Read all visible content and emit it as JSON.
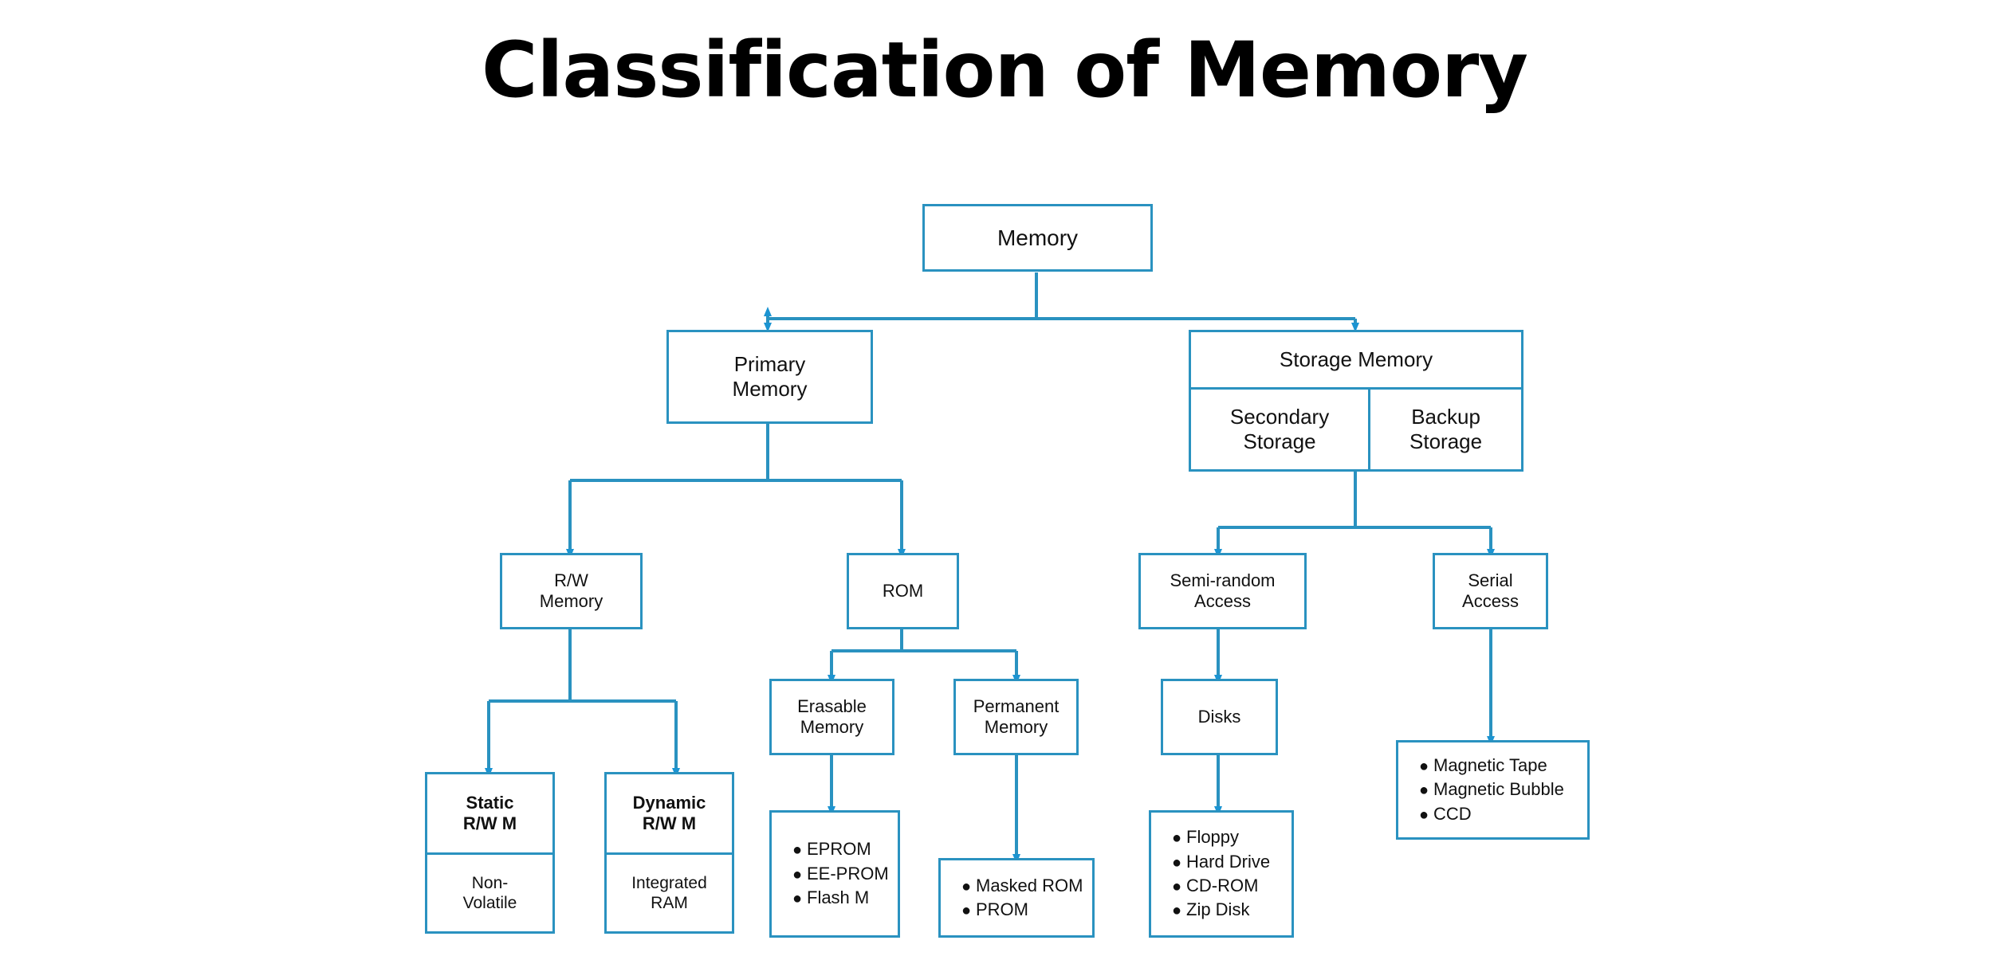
{
  "page": {
    "title": "Classification of Memory"
  },
  "theme": {
    "line_color": "#2a92c0",
    "arrow_color": "#1b94d2",
    "box_fill": "#ffffff",
    "text_color": "#111111",
    "title_color": "#000000",
    "background": "#ffffff"
  },
  "chart_data": {
    "type": "diagram",
    "subtype": "tree",
    "title": "Classification of Memory",
    "orientation": "top-down",
    "root": "Memory",
    "nodes": [
      {
        "id": "memory",
        "label": "Memory",
        "level": 0
      },
      {
        "id": "primary_memory",
        "label": "Primary Memory",
        "level": 1
      },
      {
        "id": "storage_memory",
        "label": "Storage Memory",
        "level": 1
      },
      {
        "id": "secondary_storage",
        "label": "Secondary Storage",
        "level": 1
      },
      {
        "id": "backup_storage",
        "label": "Backup Storage",
        "level": 1
      },
      {
        "id": "rw_memory",
        "label": "R/W Memory",
        "level": 2
      },
      {
        "id": "rom",
        "label": "ROM",
        "level": 2
      },
      {
        "id": "semi_random_access",
        "label": "Semi-random Access",
        "level": 2
      },
      {
        "id": "serial_access",
        "label": "Serial Access",
        "level": 2
      },
      {
        "id": "erasable_memory",
        "label": "Erasable Memory",
        "level": 3
      },
      {
        "id": "permanent_memory",
        "label": "Permanent Memory",
        "level": 3
      },
      {
        "id": "disks",
        "label": "Disks",
        "level": 3
      },
      {
        "id": "static_rw_m",
        "label": "Static R/W M",
        "level": 4
      },
      {
        "id": "dynamic_rw_m",
        "label": "Dynamic R/W M",
        "level": 4
      }
    ],
    "edges": [
      {
        "from": "memory",
        "to": "primary_memory"
      },
      {
        "from": "memory",
        "to": "storage_memory"
      },
      {
        "from": "primary_memory",
        "to": "rw_memory"
      },
      {
        "from": "primary_memory",
        "to": "rom"
      },
      {
        "from": "storage_memory",
        "to": "semi_random_access"
      },
      {
        "from": "storage_memory",
        "to": "serial_access"
      },
      {
        "from": "rw_memory",
        "to": "static_rw_m"
      },
      {
        "from": "rw_memory",
        "to": "dynamic_rw_m"
      },
      {
        "from": "rom",
        "to": "erasable_memory"
      },
      {
        "from": "rom",
        "to": "permanent_memory"
      },
      {
        "from": "semi_random_access",
        "to": "disks"
      },
      {
        "from": "erasable_memory",
        "to": "erasable_memory_list"
      },
      {
        "from": "permanent_memory",
        "to": "permanent_memory_list"
      },
      {
        "from": "disks",
        "to": "disks_list"
      },
      {
        "from": "serial_access",
        "to": "serial_access_list"
      },
      {
        "from": "static_rw_m",
        "to": "static_rw_m_sub"
      },
      {
        "from": "dynamic_rw_m",
        "to": "dynamic_rw_m_sub"
      }
    ]
  },
  "nodes": {
    "memory": {
      "label": "Memory"
    },
    "primary_memory": {
      "line1": "Primary",
      "line2": "Memory"
    },
    "storage_memory": {
      "header": "Storage Memory",
      "secondary": {
        "line1": "Secondary",
        "line2": "Storage"
      },
      "backup": {
        "line1": "Backup",
        "line2": "Storage"
      }
    },
    "rw_memory": {
      "line1": "R/W",
      "line2": "Memory"
    },
    "rom": {
      "label": "ROM"
    },
    "semi_random_access": {
      "line1": "Semi-random",
      "line2": "Access"
    },
    "serial_access": {
      "line1": "Serial",
      "line2": "Access"
    },
    "erasable_memory": {
      "line1": "Erasable",
      "line2": "Memory"
    },
    "permanent_memory": {
      "line1": "Permanent",
      "line2": "Memory"
    },
    "disks": {
      "label": "Disks"
    },
    "static_rw_m": {
      "line1": "Static",
      "line2": "R/W M",
      "sub_line1": "Non-",
      "sub_line2": "Volatile"
    },
    "dynamic_rw_m": {
      "line1": "Dynamic",
      "line2": "R/W M",
      "sub_line1": "Integrated",
      "sub_line2": "RAM"
    }
  },
  "lists": {
    "erasable_memory_list": {
      "bullet": "●",
      "items": [
        "EPROM",
        "EE-PROM",
        "Flash M"
      ]
    },
    "permanent_memory_list": {
      "bullet": "●",
      "items": [
        "Masked ROM",
        "PROM"
      ]
    },
    "disks_list": {
      "bullet": "●",
      "items": [
        "Floppy",
        "Hard Drive",
        "CD-ROM",
        "Zip Disk"
      ]
    },
    "serial_access_list": {
      "bullet": "●",
      "items": [
        "Magnetic Tape",
        "Magnetic Bubble",
        "CCD"
      ]
    }
  }
}
